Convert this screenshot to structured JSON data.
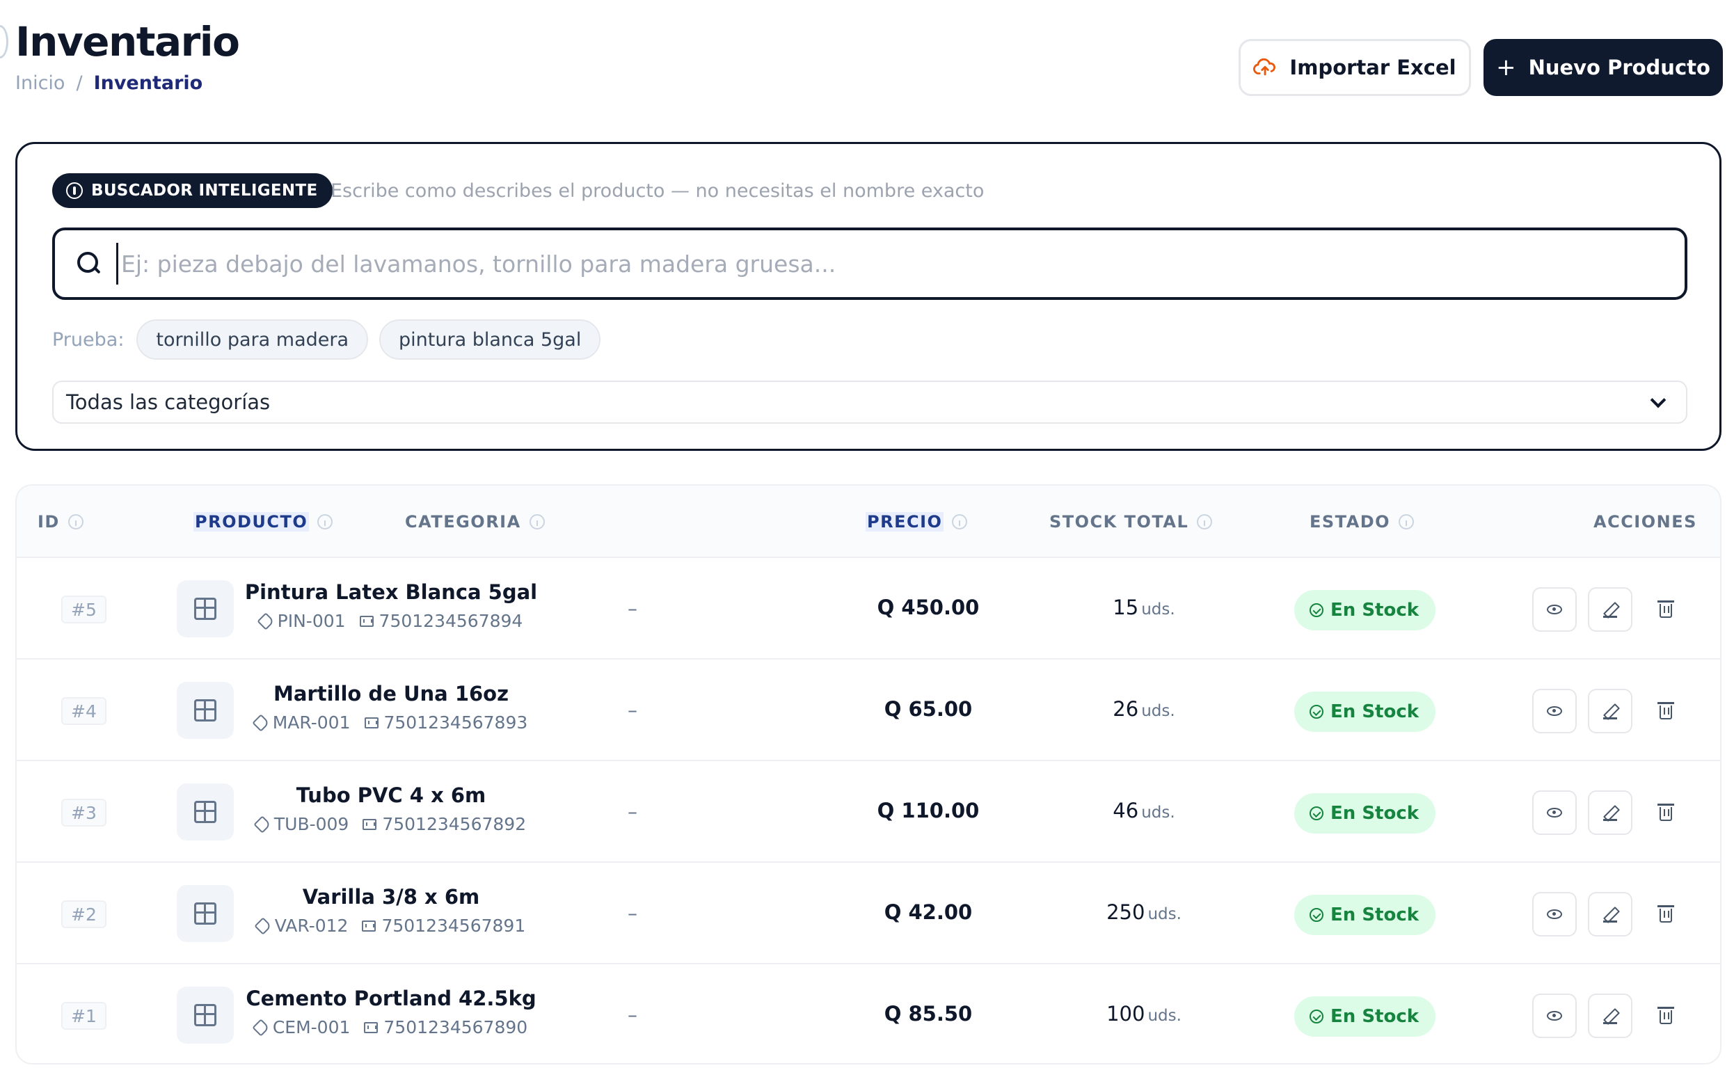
{
  "header": {
    "title": "Inventario",
    "breadcrumb": {
      "home": "Inicio",
      "separator": "/",
      "current": "Inventario"
    },
    "import_button": "Importar Excel",
    "new_button": "Nuevo Producto",
    "new_button_icon": "+"
  },
  "search": {
    "badge": "BUSCADOR INTELIGENTE",
    "hint": "Escribe como describes el producto — no necesitas el nombre exacto",
    "placeholder": "Ej: pieza debajo del lavamanos, tornillo para madera gruesa...",
    "value": "",
    "try_label": "Prueba:",
    "suggestions": [
      "tornillo para madera",
      "pintura blanca 5gal"
    ],
    "category_selected": "Todas las categorías"
  },
  "table": {
    "columns": {
      "id": "ID",
      "product": "PRODUCTO",
      "category": "CATEGORIA",
      "price": "PRECIO",
      "stock": "STOCK TOTAL",
      "status": "ESTADO",
      "actions": "ACCIONES"
    },
    "rows": [
      {
        "id": "#5",
        "name": "Pintura Latex Blanca 5gal",
        "sku": "PIN-001",
        "barcode": "7501234567894",
        "category": "–",
        "price": "Q 450.00",
        "stock": "15",
        "unit": "uds.",
        "status": "En Stock"
      },
      {
        "id": "#4",
        "name": "Martillo de Una 16oz",
        "sku": "MAR-001",
        "barcode": "7501234567893",
        "category": "–",
        "price": "Q 65.00",
        "stock": "26",
        "unit": "uds.",
        "status": "En Stock"
      },
      {
        "id": "#3",
        "name": "Tubo PVC 4 x 6m",
        "sku": "TUB-009",
        "barcode": "7501234567892",
        "category": "–",
        "price": "Q 110.00",
        "stock": "46",
        "unit": "uds.",
        "status": "En Stock"
      },
      {
        "id": "#2",
        "name": "Varilla 3/8 x 6m",
        "sku": "VAR-012",
        "barcode": "7501234567891",
        "category": "–",
        "price": "Q 42.00",
        "stock": "250",
        "unit": "uds.",
        "status": "En Stock"
      },
      {
        "id": "#1",
        "name": "Cemento Portland 42.5kg",
        "sku": "CEM-001",
        "barcode": "7501234567890",
        "category": "–",
        "price": "Q 85.50",
        "stock": "100",
        "unit": "uds.",
        "status": "En Stock"
      }
    ]
  },
  "icons": {
    "import": "cloud-upload-icon",
    "badge": "info-icon",
    "search": "search-icon",
    "dropdown": "chevron-down-icon",
    "product": "box-icon",
    "sku": "tag-icon",
    "barcode": "barcode-icon",
    "status": "check-circle-icon",
    "view": "eye-icon",
    "edit": "pencil-icon",
    "delete": "trash-icon"
  },
  "colors": {
    "primary_dark": "#101a2e",
    "accent_blue": "#1e2a78",
    "import_icon": "#ea580c",
    "status_bg": "#dcfce7",
    "status_text": "#16833f"
  }
}
